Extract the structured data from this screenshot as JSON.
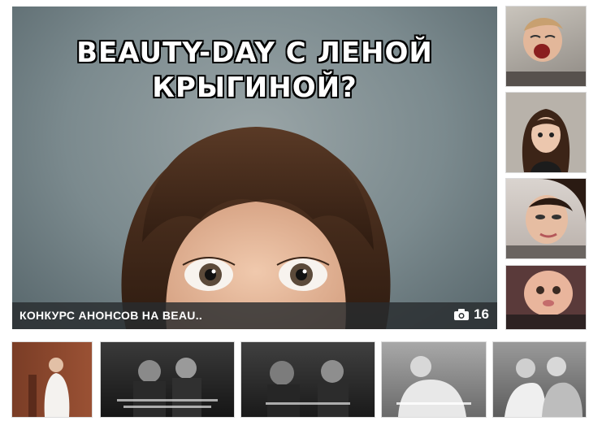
{
  "main_photo": {
    "meme_caption": "BEAUTY-DAY С ЛЕНОЙ КРЫГИНОЙ?",
    "album_title": "КОНКУРС АНОНСОВ НА BEAU..",
    "photo_count": "16",
    "camera_icon": "camera-icon"
  },
  "colors": {
    "caption_bar": "#2b2f31",
    "background": "#7b8a8e"
  }
}
